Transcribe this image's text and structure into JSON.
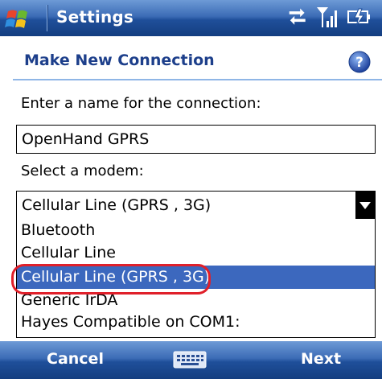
{
  "titlebar": {
    "app_title": "Settings",
    "icons": [
      "windows-start-icon",
      "data-sync-icon",
      "signal-strength-icon",
      "battery-icon"
    ]
  },
  "header": {
    "title": "Make New Connection",
    "help_icon": "help-icon"
  },
  "form": {
    "name_label": "Enter a name for the connection:",
    "name_value": "OpenHand GPRS",
    "modem_label": "Select a modem:",
    "modem_selected": "Cellular Line (GPRS , 3G)",
    "modem_options": [
      "Bluetooth",
      "Cellular Line",
      "Cellular Line (GPRS , 3G)",
      "Generic IrDA",
      "Hayes Compatible on COM1:"
    ],
    "highlighted_option_index": 2
  },
  "softkeys": {
    "left_label": "Cancel",
    "right_label": "Next",
    "center_icon": "keyboard-icon"
  },
  "colors": {
    "titlebar_blue": "#2a5aa8",
    "heading_blue": "#1d3f8b",
    "selection_blue": "#3c68be",
    "highlight_red": "#e0202a"
  }
}
